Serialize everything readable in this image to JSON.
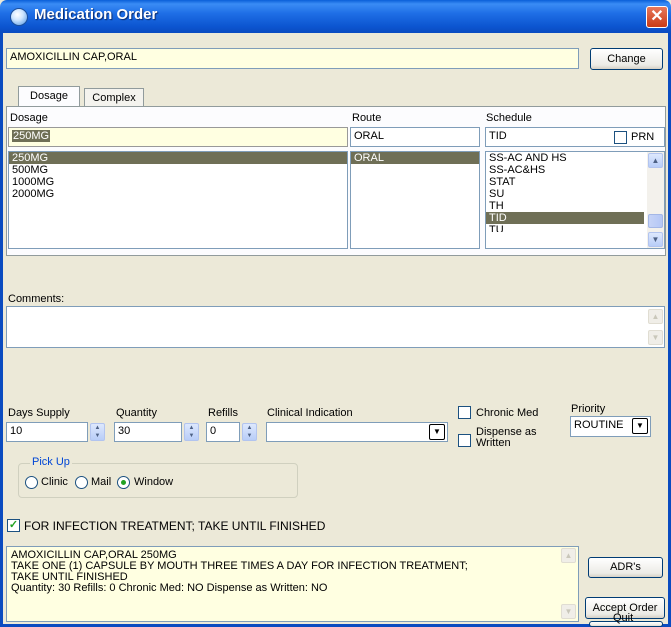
{
  "window": {
    "title": "Medication Order",
    "close_glyph": "✕"
  },
  "medication": {
    "name": "AMOXICILLIN CAP,ORAL",
    "change_label": "Change"
  },
  "tabs": [
    {
      "label": "Dosage"
    },
    {
      "label": "Complex"
    }
  ],
  "dosage": {
    "header": "Dosage",
    "value": "250MG",
    "options": [
      "250MG",
      "500MG",
      "1000MG",
      "2000MG"
    ],
    "selected": "250MG"
  },
  "route": {
    "header": "Route",
    "value": "ORAL",
    "options": [
      "ORAL"
    ],
    "selected": "ORAL"
  },
  "schedule": {
    "header": "Schedule",
    "value": "TID",
    "prn_label": "PRN",
    "options": [
      "SS-AC AND HS",
      "SS-AC&HS",
      "STAT",
      "SU",
      "TH",
      "TID",
      "TU"
    ],
    "selected": "TID"
  },
  "comments": {
    "label": "Comments:",
    "value": ""
  },
  "days_supply": {
    "label": "Days Supply",
    "value": "10"
  },
  "quantity": {
    "label": "Quantity",
    "value": "30"
  },
  "refills": {
    "label": "Refills",
    "value": "0"
  },
  "clinical_indication": {
    "label": "Clinical Indication",
    "value": ""
  },
  "chronic_med": {
    "label": "Chronic Med",
    "checked": false
  },
  "dispense_as_written": {
    "label_line1": "Dispense as",
    "label_line2": "Written",
    "checked": false
  },
  "priority": {
    "label": "Priority",
    "value": "ROUTINE"
  },
  "pickup": {
    "legend": "Pick Up",
    "options": [
      "Clinic",
      "Mail",
      "Window"
    ],
    "selected": "Window"
  },
  "indication_checkbox": {
    "label": "FOR INFECTION TREATMENT; TAKE UNTIL FINISHED",
    "checked": true
  },
  "order_text": {
    "line1": "AMOXICILLIN CAP,ORAL  250MG",
    "line2": "TAKE ONE (1) CAPSULE BY MOUTH THREE TIMES A DAY FOR INFECTION TREATMENT;",
    "line3": "TAKE UNTIL FINISHED",
    "line4": "Quantity: 30 Refills: 0 Chronic Med: NO Dispense as Written: NO"
  },
  "buttons": {
    "adr": "ADR's",
    "accept": "Accept Order",
    "quit": "Quit"
  },
  "colors": {
    "title_bar": "#0A4BC0",
    "highlight_field": "#FFFFE1",
    "selected_row": "#6F6F56",
    "window_bg": "#ECE9D8"
  }
}
